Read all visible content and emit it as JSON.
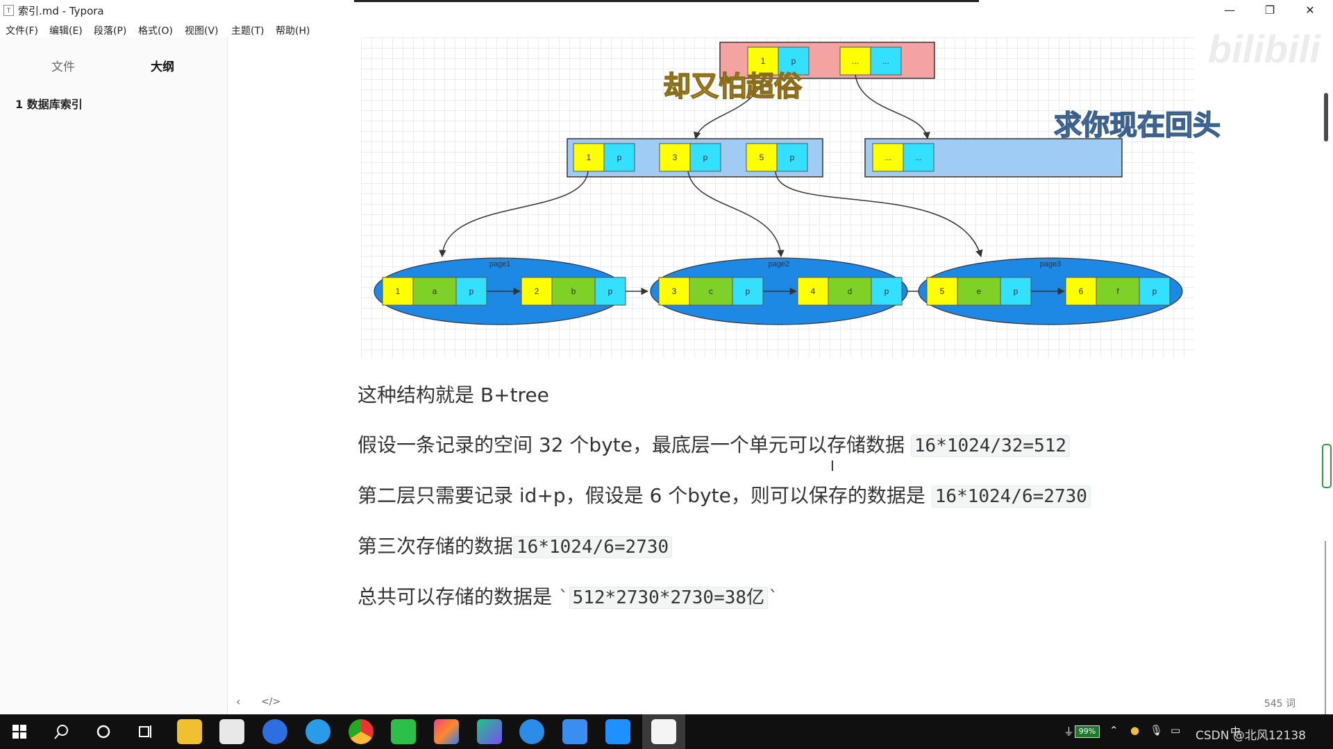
{
  "window": {
    "title": "索引.md - Typora",
    "app_icon": "T",
    "minimize_icon": "—",
    "restore_icon": "❐",
    "close_icon": "✕"
  },
  "menu": [
    "文件(F)",
    "编辑(E)",
    "段落(P)",
    "格式(O)",
    "视图(V)",
    "主题(T)",
    "帮助(H)"
  ],
  "sidebar": {
    "tab_files": "文件",
    "tab_outline": "大纲",
    "outline_items": [
      "1 数据库索引"
    ]
  },
  "diagram": {
    "root_cells": [
      {
        "key": "1",
        "ptr": "p"
      },
      {
        "key": "...",
        "ptr": "..."
      }
    ],
    "level2_left": [
      {
        "key": "1",
        "ptr": "p"
      },
      {
        "key": "3",
        "ptr": "p"
      },
      {
        "key": "5",
        "ptr": "p"
      }
    ],
    "level2_right": [
      {
        "key": "...",
        "ptr": "..."
      }
    ],
    "pages": [
      {
        "label": "page1",
        "records": [
          {
            "key": "1",
            "data": "a",
            "ptr": "p"
          },
          {
            "key": "2",
            "data": "b",
            "ptr": "p"
          }
        ]
      },
      {
        "label": "page2",
        "records": [
          {
            "key": "3",
            "data": "c",
            "ptr": "p"
          },
          {
            "key": "4",
            "data": "d",
            "ptr": "p"
          }
        ]
      },
      {
        "label": "page3",
        "records": [
          {
            "key": "5",
            "data": "e",
            "ptr": "p"
          },
          {
            "key": "6",
            "data": "f",
            "ptr": "p"
          }
        ]
      }
    ],
    "colors": {
      "root_fill": "#f4a3a3",
      "node_fill": "#9fcbf5",
      "page_fill": "#1e88e5",
      "key_fill": "#ffff00",
      "ptr_fill": "#33e0ff",
      "data_fill": "#7fd128"
    }
  },
  "content": {
    "p1": "这种结构就是 B+tree",
    "p2_text": "假设一条记录的空间 32 个byte，最底层一个单元可以存储数据",
    "p2_code": "16*1024/32=512",
    "p3_text": "第二层只需要记录 id+p，假设是 6 个byte，则可以保存的数据是",
    "p3_code": "16*1024/6=2730",
    "p4_text": "第三次存储的数据",
    "p4_code": "16*1024/6=2730",
    "p5_text": "总共可以存储的数据是",
    "p5_tick_open": "`",
    "p5_code": "512*2730*2730=38亿",
    "p5_tick_close": "`"
  },
  "overlays": {
    "danmaku_1": "却又怕超俗",
    "danmaku_2": "求你现在回头",
    "watermark": "bilibili",
    "csdn": "CSDN @北风12138"
  },
  "statusbar": {
    "back_icon": "‹",
    "source_icon": "</>",
    "word_count": "545 词"
  },
  "taskbar": {
    "battery": "99%",
    "tray_text": "中"
  }
}
